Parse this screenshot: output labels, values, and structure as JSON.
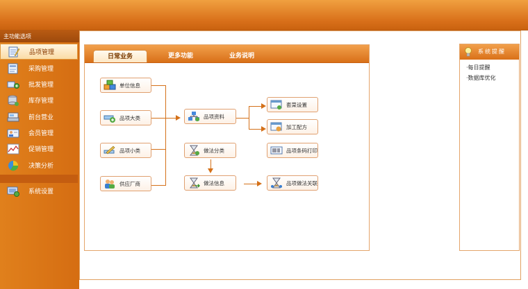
{
  "sidebar": {
    "header": "主功能选项",
    "items": [
      {
        "label": "品项管理",
        "icon": "edit-document-icon",
        "active": true
      },
      {
        "label": "采购管理",
        "icon": "purchase-form-icon"
      },
      {
        "label": "批发管理",
        "icon": "wholesale-transfer-icon"
      },
      {
        "label": "库存管理",
        "icon": "inventory-database-icon"
      },
      {
        "label": "前台营业",
        "icon": "cash-register-icon"
      },
      {
        "label": "会员管理",
        "icon": "member-card-icon"
      },
      {
        "label": "促销管理",
        "icon": "promotion-chart-icon"
      },
      {
        "label": "决策分析",
        "icon": "pie-chart-icon"
      }
    ],
    "settings": {
      "label": "系统设置",
      "icon": "system-settings-icon"
    }
  },
  "tabs": [
    {
      "label": "日常业务",
      "active": true
    },
    {
      "label": "更多功能"
    },
    {
      "label": "业务说明"
    }
  ],
  "flow": {
    "unit_info": "单位信息",
    "category_major": "品项大类",
    "category_minor": "品项小类",
    "supplier": "供应厂商",
    "item_data": "品项资料",
    "method_category": "做法分类",
    "method_info": "做法信息",
    "combo_settings": "套菜设置",
    "processing_recipe": "加工配方",
    "barcode_print": "品项条码打印",
    "method_link": "品项做法关联"
  },
  "reminder": {
    "title": "系统提醒",
    "links": [
      "·每日提醒",
      "·数据库优化"
    ]
  },
  "colors": {
    "accent": "#d97018",
    "header_dark": "#9e4a0c",
    "active_bg": "#fbdca6"
  }
}
